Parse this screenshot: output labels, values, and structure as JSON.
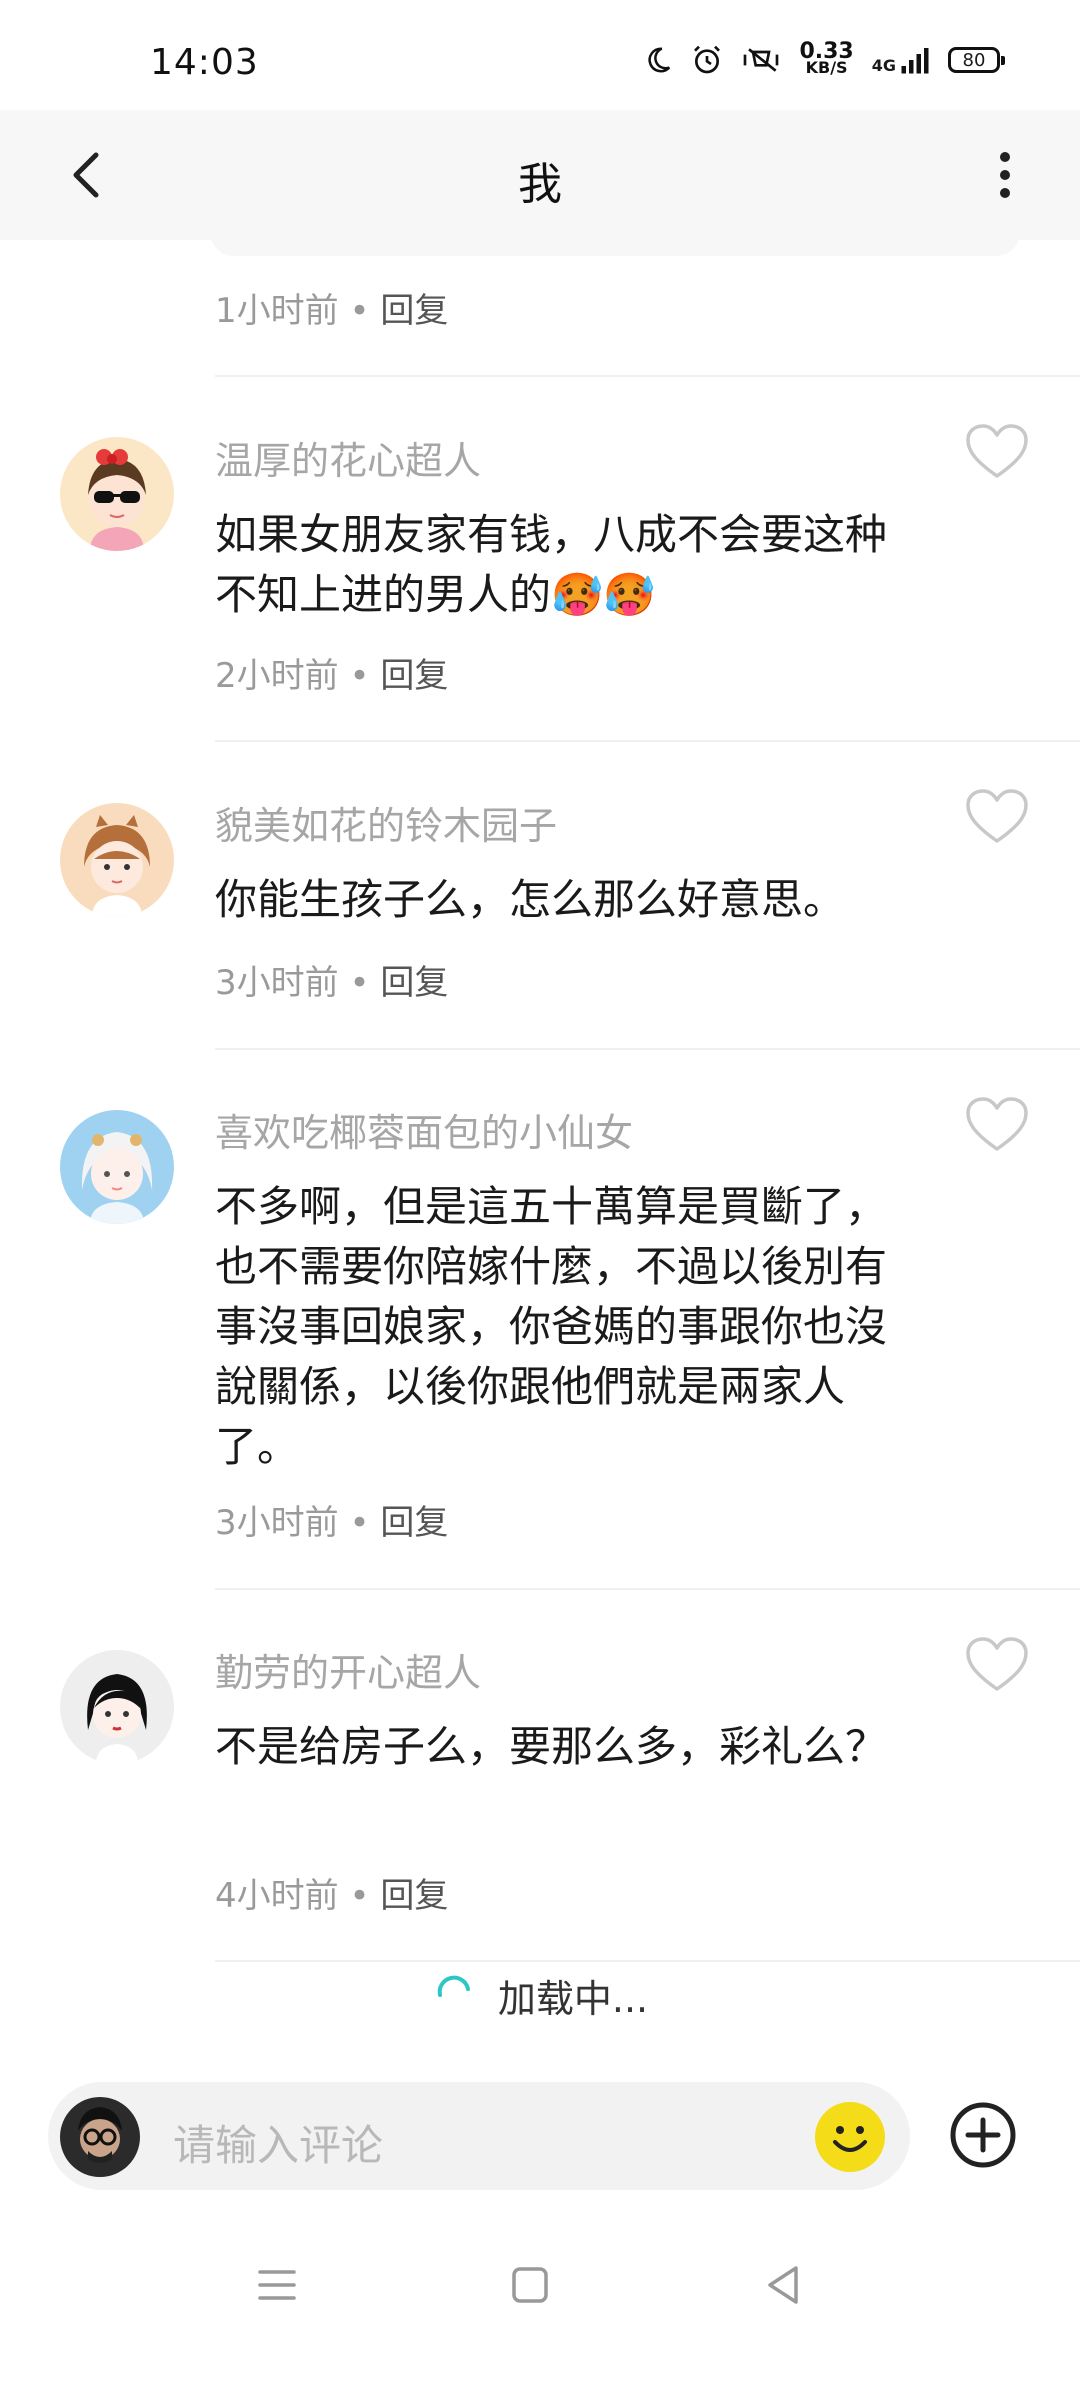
{
  "status_bar": {
    "time": "14:03",
    "net_speed_value": "0.33",
    "net_speed_unit": "KB/S",
    "network": "4G",
    "battery": "80"
  },
  "header": {
    "title": "我"
  },
  "previous_comment": {
    "time": "1小时前",
    "reply_label": "回复"
  },
  "comments": [
    {
      "username": "温厚的花心超人",
      "text": "如果女朋友家有钱，八成不会要这种不知上进的男人的🥵🥵",
      "time": "2小时前",
      "reply_label": "回复"
    },
    {
      "username": "貌美如花的铃木园子",
      "text": "你能生孩子么，怎么那么好意思。",
      "time": "3小时前",
      "reply_label": "回复"
    },
    {
      "username": "喜欢吃椰蓉面包的小仙女",
      "text": "不多啊，但是這五十萬算是買斷了，也不需要你陪嫁什麼，不過以後別有事沒事回娘家，你爸媽的事跟你也沒說關係，以後你跟他們就是兩家人了。",
      "time": "3小时前",
      "reply_label": "回复"
    },
    {
      "username": "勤劳的开心超人",
      "text": "不是给房子么，要那么多，彩礼么？",
      "time": "4小时前",
      "reply_label": "回复"
    }
  ],
  "loading_text": "加载中...",
  "input": {
    "placeholder": "请输入评论"
  },
  "icons": {
    "back": "chevron-left-icon",
    "more": "more-vertical-icon",
    "like": "heart-outline-icon",
    "emoji": "smiley-icon",
    "add": "plus-circle-icon"
  },
  "colors": {
    "emoji_yellow": "#f5dc19",
    "loading_spinner": "#2cc6c6",
    "username_gray": "#a6a6a6"
  }
}
